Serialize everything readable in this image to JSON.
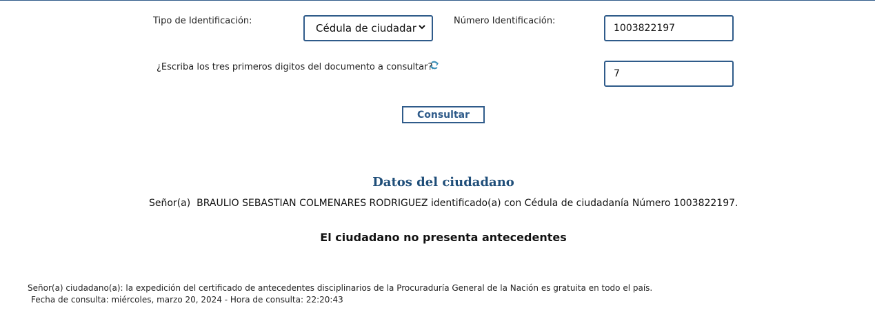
{
  "form": {
    "id_type_label": "Tipo de Identificación:",
    "id_type_selected": "Cédula de ciudadar",
    "id_number_label": "Número Identificación:",
    "id_number_value": "1003822197",
    "captcha_question": "¿Escriba los tres primeros digitos del documento a consultar?",
    "captcha_answer": "7",
    "submit_label": "Consultar"
  },
  "result": {
    "section_title": "Datos del ciudadano",
    "citizen_prefix": "Señor(a)",
    "citizen_name": "BRAULIO SEBASTIAN COLMENARES RODRIGUEZ",
    "citizen_middle": "identificado(a) con Cédula de ciudadanía Número",
    "citizen_number": "1003822197.",
    "status_message": "El ciudadano no presenta antecedentes"
  },
  "footer": {
    "notice": "Señor(a) ciudadano(a): la expedición del certificado de antecedentes disciplinarios de la Procuraduría General de la Nación es gratuita en todo el país.",
    "consult_date": "Fecha de consulta: miércoles, marzo 20, 2024 - Hora de consulta: 22:20:43"
  },
  "icons": {
    "refresh": "refresh-icon",
    "dropdown": "chevron-down-icon"
  },
  "colors": {
    "accent": "#2f5b8a",
    "title": "#1f4e79"
  }
}
